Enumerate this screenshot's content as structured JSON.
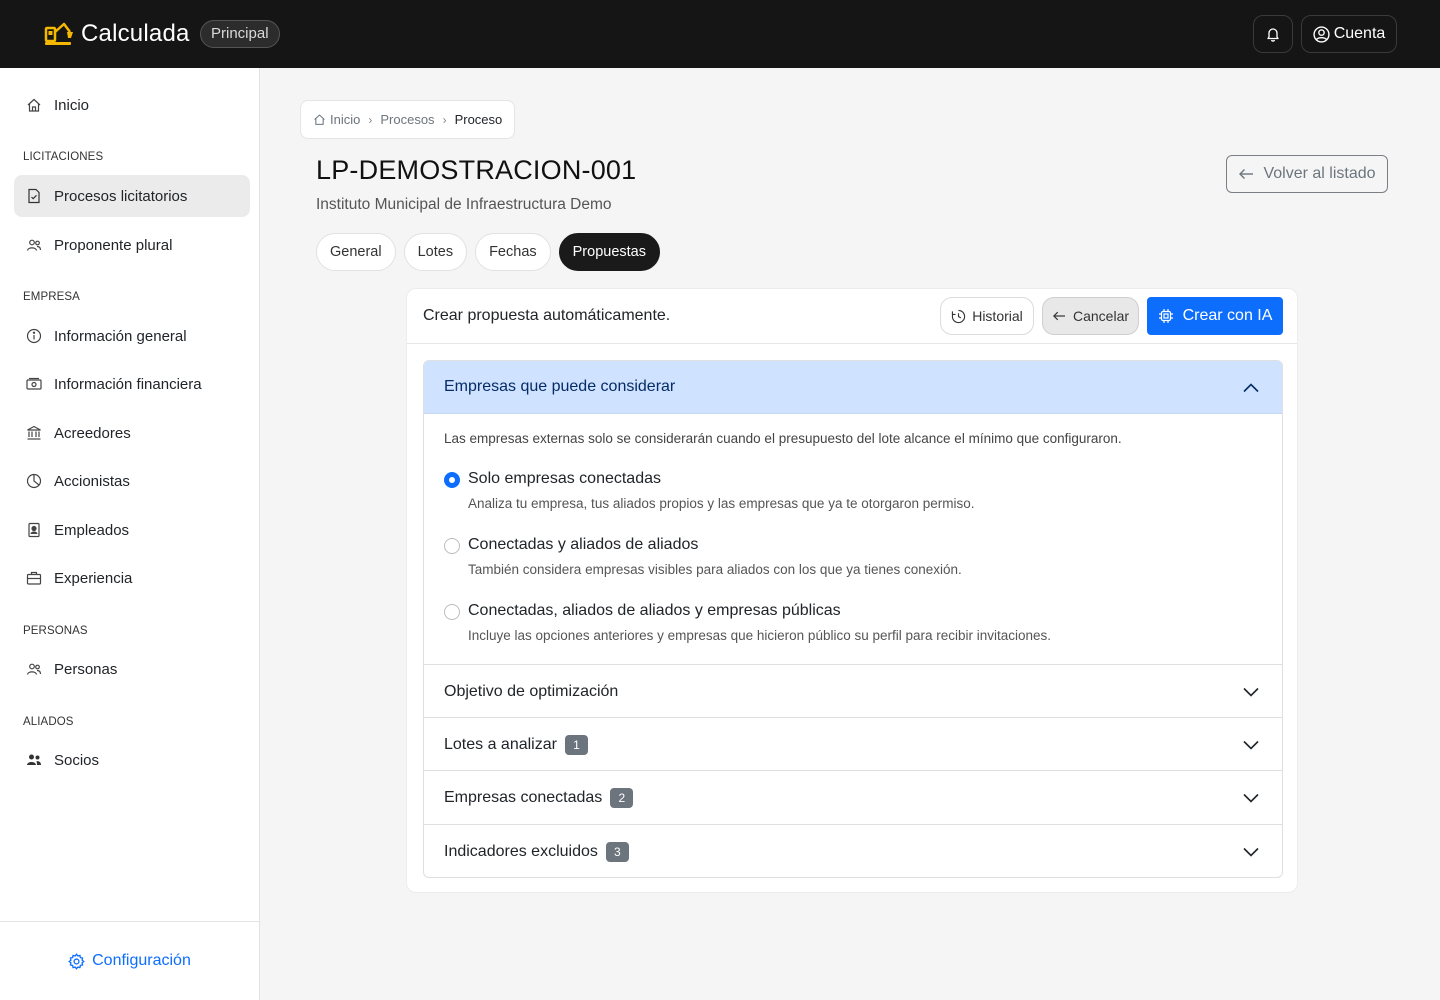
{
  "app": {
    "brand": "Calculada",
    "environment": "Principal",
    "account_label": "Cuenta"
  },
  "sidebar": {
    "home": "Inicio",
    "sections": [
      {
        "title": "LICITACIONES",
        "items": [
          {
            "label": "Procesos licitatorios",
            "icon": "file-check-icon",
            "active": true
          },
          {
            "label": "Proponente plural",
            "icon": "users-icon"
          }
        ]
      },
      {
        "title": "EMPRESA",
        "items": [
          {
            "label": "Información general",
            "icon": "info-icon"
          },
          {
            "label": "Información financiera",
            "icon": "cash-icon"
          },
          {
            "label": "Acreedores",
            "icon": "bank-icon"
          },
          {
            "label": "Accionistas",
            "icon": "pie-chart-icon"
          },
          {
            "label": "Empleados",
            "icon": "person-badge-icon"
          },
          {
            "label": "Experiencia",
            "icon": "briefcase-icon"
          }
        ]
      },
      {
        "title": "PERSONAS",
        "items": [
          {
            "label": "Personas",
            "icon": "users-icon"
          }
        ]
      },
      {
        "title": "ALIADOS",
        "items": [
          {
            "label": "Socios",
            "icon": "people-fill-icon"
          }
        ]
      }
    ],
    "footer": "Configuración"
  },
  "breadcrumb": [
    "Inicio",
    "Procesos",
    "Proceso"
  ],
  "page": {
    "title": "LP-DEMOSTRACION-001",
    "subtitle": "Instituto Municipal de Infraestructura Demo",
    "back_label": "Volver al listado"
  },
  "tabs": [
    {
      "label": "General",
      "active": false
    },
    {
      "label": "Lotes",
      "active": false
    },
    {
      "label": "Fechas",
      "active": false
    },
    {
      "label": "Propuestas",
      "active": true
    }
  ],
  "card": {
    "title": "Crear propuesta automáticamente.",
    "history_label": "Historial",
    "cancel_label": "Cancelar",
    "ai_label": "Crear con IA"
  },
  "accordion": {
    "open_section": {
      "title": "Empresas que puede considerar",
      "note": "Las empresas externas solo se considerarán cuando el presupuesto del lote alcance el mínimo que configuraron.",
      "options": [
        {
          "label": "Solo empresas conectadas",
          "description": "Analiza tu empresa, tus aliados propios y las empresas que ya te otorgaron permiso.",
          "checked": true
        },
        {
          "label": "Conectadas y aliados de aliados",
          "description": "También considera empresas visibles para aliados con los que ya tienes conexión.",
          "checked": false
        },
        {
          "label": "Conectadas, aliados de aliados y empresas públicas",
          "description": "Incluye las opciones anteriores y empresas que hicieron público su perfil para recibir invitaciones.",
          "checked": false
        }
      ]
    },
    "collapsed_sections": [
      {
        "title": "Objetivo de optimización",
        "count": ""
      },
      {
        "title": "Lotes a analizar",
        "count": "1"
      },
      {
        "title": "Empresas conectadas",
        "count": "2"
      },
      {
        "title": "Indicadores excluidos",
        "count": "3"
      }
    ]
  },
  "colors": {
    "primary": "#0d6efd",
    "topbar": "#151515",
    "accordion_open_bg": "#cfe2ff",
    "logo": "#f5b800"
  }
}
